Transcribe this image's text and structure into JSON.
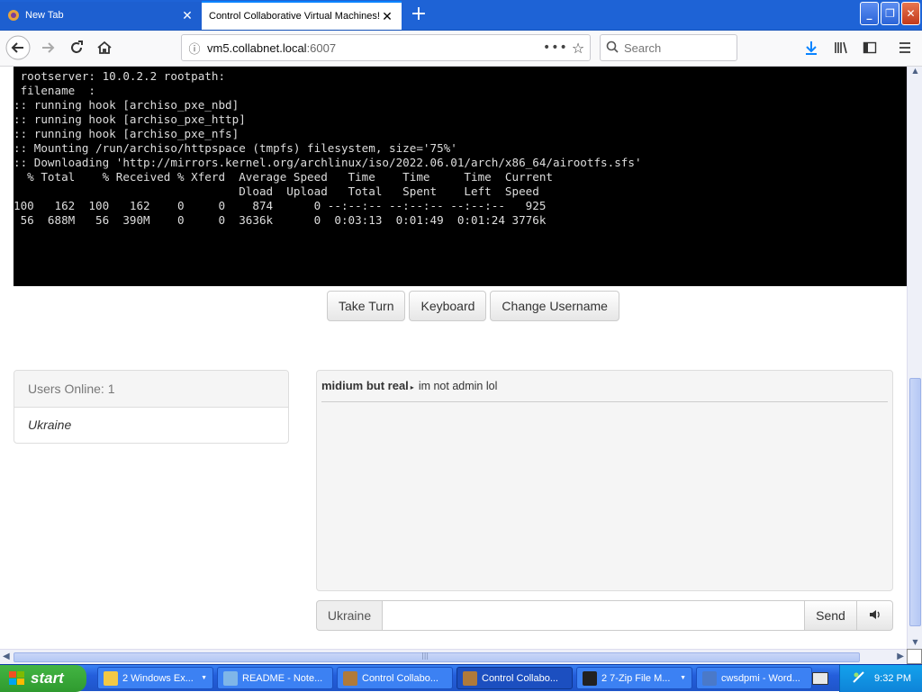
{
  "browser": {
    "tabs": [
      {
        "title": "New Tab",
        "active": false
      },
      {
        "title": "Control Collaborative Virtual Machines!",
        "active": true
      }
    ],
    "url_host": "vm5.collabnet.local",
    "url_port": ":6007",
    "search_placeholder": "Search"
  },
  "terminal": {
    "lines": [
      " rootserver: 10.0.2.2 rootpath:",
      " filename  :",
      ":: running hook [archiso_pxe_nbd]",
      ":: running hook [archiso_pxe_http]",
      ":: running hook [archiso_pxe_nfs]",
      ":: Mounting /run/archiso/httpspace (tmpfs) filesystem, size='75%'",
      ":: Downloading 'http://mirrors.kernel.org/archlinux/iso/2022.06.01/arch/x86_64/airootfs.sfs'",
      "  % Total    % Received % Xferd  Average Speed   Time    Time     Time  Current",
      "                                 Dload  Upload   Total   Spent    Left  Speed",
      "100   162  100   162    0     0    874      0 --:--:-- --:--:-- --:--:--   925",
      " 56  688M   56  390M    0     0  3636k      0  0:03:13  0:01:49  0:01:24 3776k"
    ]
  },
  "controls": {
    "take_turn": "Take Turn",
    "keyboard": "Keyboard",
    "change_username": "Change Username"
  },
  "users": {
    "header": "Users Online: 1",
    "list": [
      "Ukraine"
    ]
  },
  "chat": {
    "messages": [
      {
        "user": "midium but real",
        "text": "im not admin lol"
      }
    ],
    "username": "Ukraine",
    "input_value": "",
    "send_label": "Send"
  },
  "taskbar": {
    "start_label": "start",
    "items": [
      {
        "label": "2 Windows Ex...",
        "icon_color": "#f3c945",
        "active": false,
        "group": true
      },
      {
        "label": "README - Note...",
        "icon_color": "#7fb6e8",
        "active": false,
        "group": false
      },
      {
        "label": "Control Collabo...",
        "icon_color": "#b07a3a",
        "active": false,
        "group": false
      },
      {
        "label": "Control Collabo...",
        "icon_color": "#b07a3a",
        "active": true,
        "group": false
      },
      {
        "label": "2 7-Zip File M...",
        "icon_color": "#222222",
        "active": false,
        "group": true
      },
      {
        "label": "cwsdpmi - Word...",
        "icon_color": "#4a79c9",
        "active": false,
        "group": false
      }
    ],
    "clock": "9:32 PM"
  }
}
